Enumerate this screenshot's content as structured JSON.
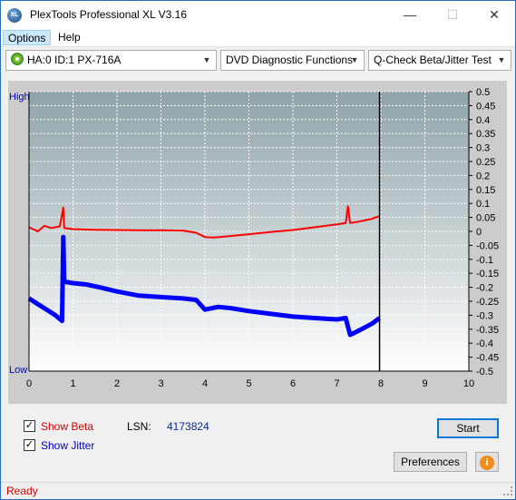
{
  "window": {
    "title": "PlexTools Professional XL V3.16",
    "icon_text": "XL",
    "minimize_glyph": "—",
    "maximize_glyph": "☐",
    "close_glyph": "✕"
  },
  "menu": [
    {
      "label": "Options"
    },
    {
      "label": "Help"
    }
  ],
  "toolbar": {
    "drive": "HA:0 ID:1  PX-716A",
    "function": "DVD Diagnostic Functions",
    "test": "Q-Check Beta/Jitter Test"
  },
  "chart_data": {
    "type": "line",
    "left_axis_labels": {
      "top": "High",
      "bottom": "Low"
    },
    "x_ticks": [
      "0",
      "1",
      "2",
      "3",
      "4",
      "5",
      "6",
      "7",
      "8",
      "9",
      "10"
    ],
    "xlim": [
      0,
      10
    ],
    "y_right_ticks": [
      "0.5",
      "0.45",
      "0.4",
      "0.35",
      "0.3",
      "0.25",
      "0.2",
      "0.15",
      "0.1",
      "0.05",
      "0",
      "-0.05",
      "-0.1",
      "-0.15",
      "-0.2",
      "-0.25",
      "-0.3",
      "-0.35",
      "-0.4",
      "-0.45",
      "-0.5"
    ],
    "ylim": [
      -0.5,
      0.5
    ],
    "grid": true,
    "end_marker_x": 7.97,
    "series": [
      {
        "key": "beta",
        "color": "#ff0000",
        "x": [
          0.0,
          0.2,
          0.35,
          0.5,
          0.7,
          0.78,
          0.8,
          1.0,
          1.5,
          2.0,
          2.5,
          3.0,
          3.5,
          3.8,
          4.0,
          4.2,
          4.5,
          5.0,
          5.5,
          6.0,
          6.5,
          7.0,
          7.2,
          7.25,
          7.3,
          7.5,
          7.8,
          7.97
        ],
        "y": [
          0.015,
          0.0,
          0.02,
          0.012,
          0.018,
          0.085,
          0.012,
          0.008,
          0.006,
          0.005,
          0.004,
          0.004,
          0.003,
          -0.005,
          -0.02,
          -0.022,
          -0.018,
          -0.01,
          -0.002,
          0.005,
          0.015,
          0.025,
          0.03,
          0.09,
          0.03,
          0.035,
          0.045,
          0.055
        ]
      },
      {
        "key": "jitter",
        "color": "#0000ff",
        "x": [
          0.0,
          0.2,
          0.4,
          0.6,
          0.75,
          0.78,
          0.8,
          1.0,
          1.3,
          1.6,
          2.0,
          2.5,
          3.0,
          3.5,
          3.8,
          4.0,
          4.3,
          4.6,
          5.0,
          5.5,
          6.0,
          6.5,
          7.0,
          7.2,
          7.3,
          7.5,
          7.8,
          7.97
        ],
        "y": [
          -0.24,
          -0.26,
          -0.28,
          -0.3,
          -0.32,
          -0.02,
          -0.18,
          -0.185,
          -0.19,
          -0.2,
          -0.215,
          -0.23,
          -0.235,
          -0.24,
          -0.245,
          -0.28,
          -0.27,
          -0.275,
          -0.285,
          -0.295,
          -0.305,
          -0.31,
          -0.315,
          -0.31,
          -0.37,
          -0.355,
          -0.33,
          -0.31
        ]
      }
    ]
  },
  "controls": {
    "show_beta_label": "Show Beta",
    "show_beta_checked": true,
    "show_beta_color": "#d40000",
    "show_jitter_label": "Show Jitter",
    "show_jitter_checked": true,
    "show_jitter_color": "#0000cc",
    "lsn_label": "LSN:",
    "lsn_value": "4173824",
    "start_label": "Start",
    "preferences_label": "Preferences",
    "info_glyph": "i",
    "check_glyph": "✓"
  },
  "status": {
    "text": "Ready"
  }
}
